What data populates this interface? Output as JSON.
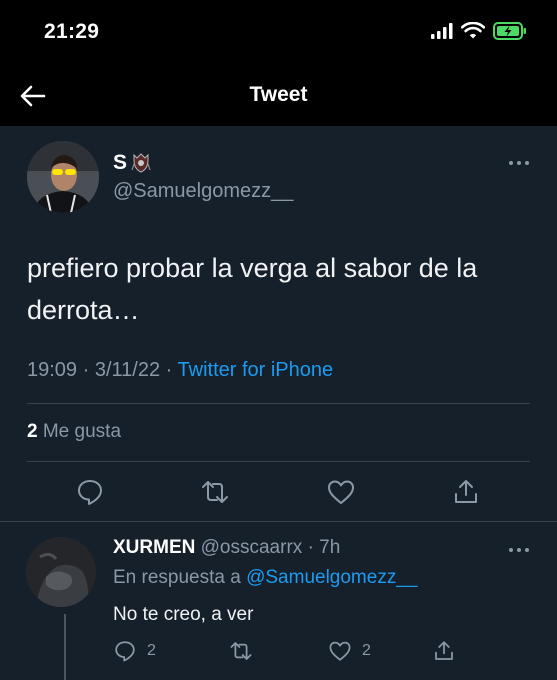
{
  "status_bar": {
    "time": "21:29"
  },
  "nav": {
    "title": "Tweet"
  },
  "tweet": {
    "author_name": "S",
    "author_handle": "@Samuelgomezz__",
    "text": "prefiero probar la verga al sabor de la derrota…",
    "time": "19:09",
    "date": "3/11/22",
    "source": "Twitter for iPhone",
    "likes_count": "2",
    "likes_label": "Me gusta"
  },
  "reply": {
    "author_name": "XURMEN",
    "author_handle": "@osscaarrx",
    "age": "7h",
    "in_reply_to_label": "En respuesta a",
    "in_reply_to_handle": "@Samuelgomezz__",
    "text": "No te creo, a ver",
    "reply_count": "2",
    "like_count": "2"
  },
  "colors": {
    "accent": "#1d9bf0",
    "background": "#15202b",
    "muted": "#8b98a5",
    "divider": "#38444d",
    "battery": "#4cd964"
  },
  "icons": [
    "back-arrow-icon",
    "signal-icon",
    "wifi-icon",
    "battery-icon",
    "more-icon",
    "reply-icon",
    "retweet-icon",
    "like-icon",
    "share-icon"
  ]
}
